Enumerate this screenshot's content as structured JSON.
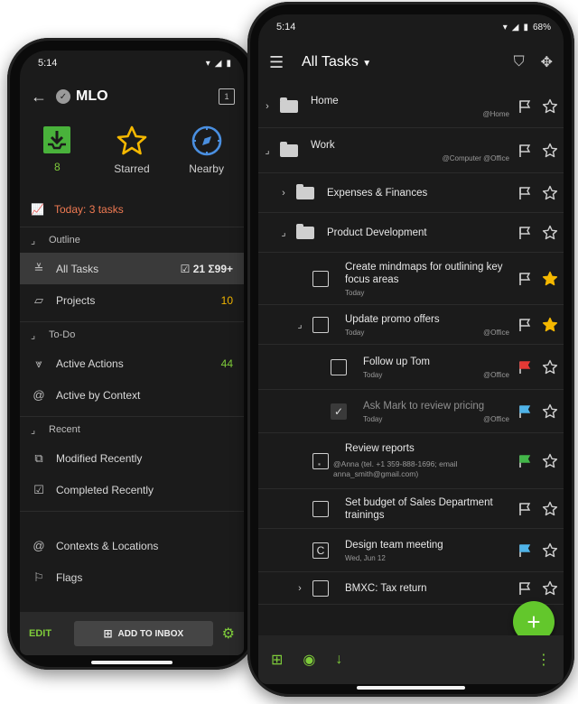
{
  "left": {
    "status": {
      "time": "5:14"
    },
    "header": {
      "title": "MLO"
    },
    "quick": [
      {
        "label": "8",
        "icon": "inbox-icon"
      },
      {
        "label": "Starred",
        "icon": "star-icon"
      },
      {
        "label": "Nearby",
        "icon": "compass-icon"
      }
    ],
    "today": "Today: 3 tasks",
    "sections": {
      "outline": "Outline",
      "todo": "To-Do",
      "recent": "Recent"
    },
    "items": {
      "all_tasks": {
        "label": "All Tasks",
        "count_checked": "21",
        "count_sigma": "99+"
      },
      "projects": {
        "label": "Projects",
        "count": "10"
      },
      "active_actions": {
        "label": "Active Actions",
        "count": "44"
      },
      "active_by_context": {
        "label": "Active by Context"
      },
      "modified_recently": {
        "label": "Modified Recently"
      },
      "completed_recently": {
        "label": "Completed Recently"
      },
      "contexts_locations": {
        "label": "Contexts & Locations"
      },
      "flags": {
        "label": "Flags"
      }
    },
    "footer": {
      "edit": "EDIT",
      "add_to_inbox": "ADD TO INBOX"
    }
  },
  "right": {
    "status": {
      "time": "5:14",
      "battery": "68%"
    },
    "header": {
      "title": "All Tasks"
    },
    "rows": [
      {
        "type": "folder",
        "text": "Home",
        "context": "@Home",
        "date": "",
        "expander": "›",
        "indent": 0,
        "flag": "outline",
        "star": false
      },
      {
        "type": "folder",
        "text": "Work",
        "context": "@Computer  @Office",
        "date": "",
        "expander": "⌟",
        "indent": 0,
        "flag": "outline",
        "star": false
      },
      {
        "type": "folder",
        "text": "Expenses & Finances",
        "context": "",
        "date": "",
        "expander": "›",
        "indent": 1,
        "flag": "outline",
        "star": false
      },
      {
        "type": "folder",
        "text": "Product Development",
        "context": "",
        "date": "",
        "expander": "⌟",
        "indent": 1,
        "flag": "outline",
        "star": false
      },
      {
        "type": "task",
        "text": "Create mindmaps for outlining key focus areas",
        "context": "",
        "date": "Today",
        "expander": "",
        "indent": 2,
        "flag": "outline",
        "star": true
      },
      {
        "type": "task",
        "text": "Update promo offers",
        "context": "@Office",
        "date": "Today",
        "expander": "⌟",
        "indent": 2,
        "flag": "outline",
        "star": true
      },
      {
        "type": "task",
        "text": "Follow up Tom",
        "context": "@Office",
        "date": "Today",
        "expander": "",
        "indent": 3,
        "flag": "red",
        "star": false
      },
      {
        "type": "done",
        "text": "Ask Mark to review pricing",
        "context": "@Office",
        "date": "Today",
        "expander": "",
        "indent": 3,
        "flag": "blue",
        "star": false
      },
      {
        "type": "task",
        "text": "Review reports",
        "context": "",
        "date": "",
        "note": "@Anna (tel. +1 359-888-1696; email anna_smith@gmail.com)",
        "expander": "",
        "indent": 2,
        "flag": "green",
        "star": false
      },
      {
        "type": "task",
        "text": "Set budget of Sales Department trainings",
        "context": "",
        "date": "",
        "expander": "",
        "indent": 2,
        "flag": "outline",
        "star": false
      },
      {
        "type": "recurring",
        "text": "Design team meeting",
        "context": "",
        "date": "Wed, Jun 12",
        "expander": "",
        "indent": 2,
        "flag": "blue",
        "star": false
      },
      {
        "type": "task",
        "text": "BMXC: Tax return",
        "context": "",
        "date": "",
        "expander": "›",
        "indent": 2,
        "flag": "outline",
        "star": false
      }
    ],
    "colors": {
      "accent": "#63c72c",
      "star": "#f5b800",
      "flag_red": "#e53935",
      "flag_blue": "#4fb3e8",
      "flag_green": "#43b649"
    }
  }
}
